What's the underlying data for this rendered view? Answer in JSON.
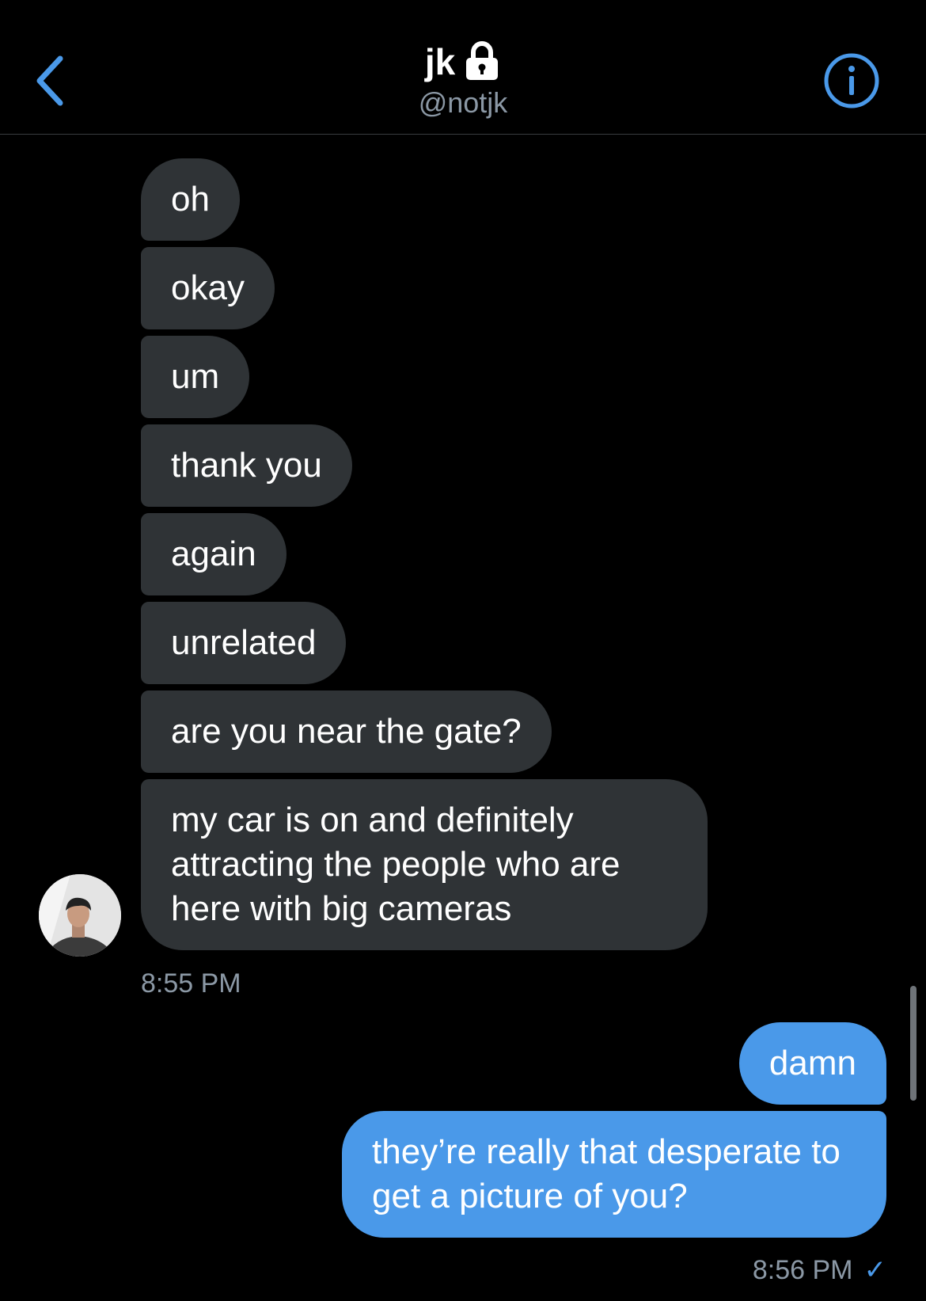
{
  "header": {
    "name": "jk",
    "handle": "@notjk",
    "back_icon": "chevron-left-icon",
    "lock_icon": "lock-icon",
    "info_icon": "info-icon",
    "accent_color": "#4a99e9"
  },
  "messages": {
    "received": [
      "oh",
      "okay",
      "um",
      "thank you",
      "again",
      "unrelated",
      "are you near the gate?",
      "my car is on and definitely attracting the people who are here with big cameras"
    ],
    "received_time": "8:55 PM",
    "sent": [
      "damn",
      "they’re really that desperate to get a picture of you?"
    ],
    "sent_time": "8:56 PM",
    "sent_status_icon": "checkmark-icon",
    "received_bubble_color": "#2f3336",
    "sent_bubble_color": "#4a99e9"
  }
}
